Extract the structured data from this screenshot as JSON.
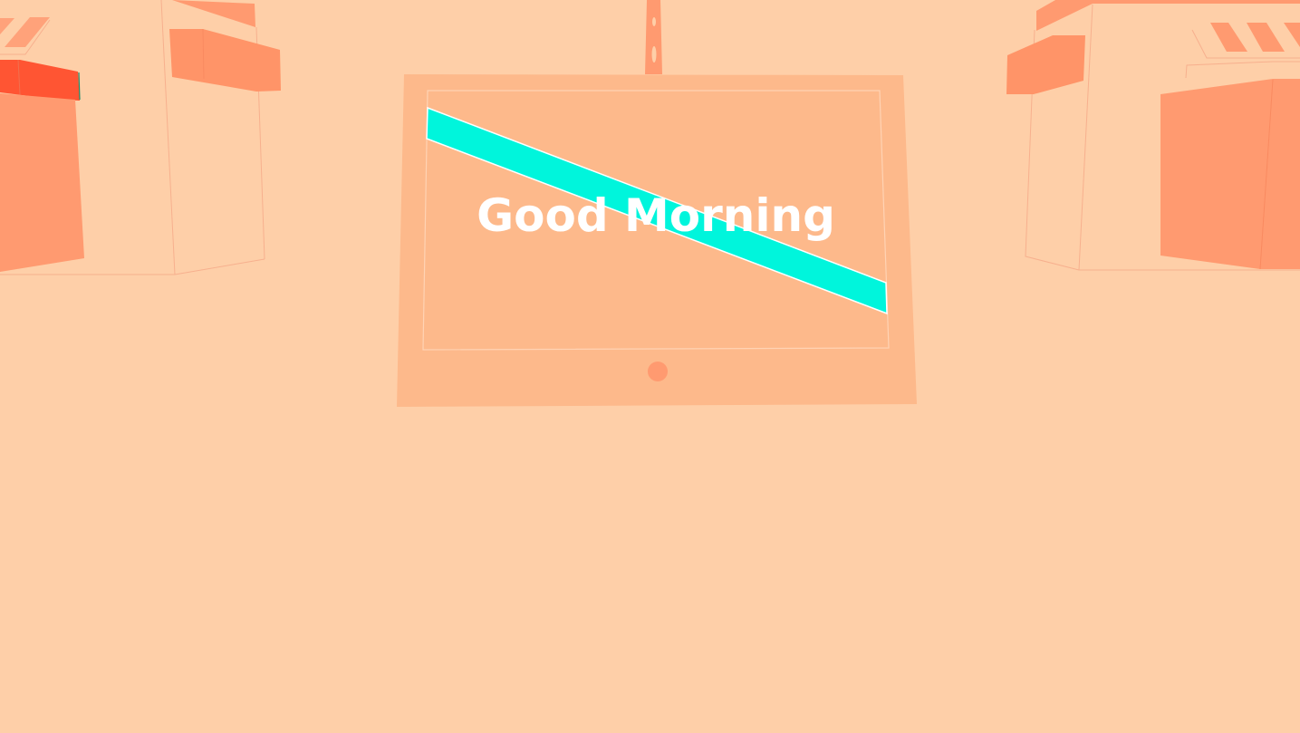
{
  "screen": {
    "greeting": "Good Morning"
  },
  "colors": {
    "background": "#FECFA8",
    "tablet": "#FDB98B",
    "accent_salmon": "#FF9A70",
    "accent_red": "#FF5533",
    "stripe": "#00F5DC",
    "outline": "#F7B08E"
  }
}
